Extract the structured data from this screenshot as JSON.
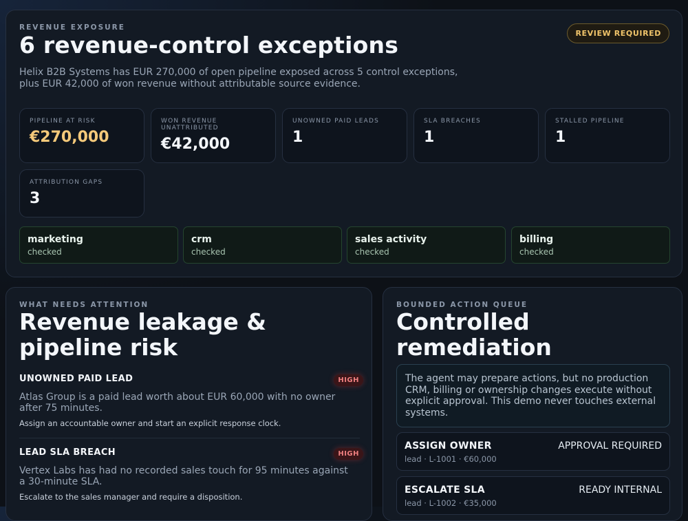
{
  "header": {
    "eyebrow": "REVENUE EXPOSURE",
    "title": "6 revenue-control exceptions",
    "badge": "REVIEW REQUIRED",
    "summary": "Helix B2B Systems has EUR 270,000 of open pipeline exposed across 5 control exceptions, plus EUR 42,000 of won revenue without attributable source evidence."
  },
  "metrics": [
    {
      "label": "PIPELINE AT RISK",
      "value": "€270,000"
    },
    {
      "label": "WON REVENUE UNATTRIBUTED",
      "value": "€42,000"
    },
    {
      "label": "UNOWNED PAID LEADS",
      "value": "1"
    },
    {
      "label": "SLA BREACHES",
      "value": "1"
    },
    {
      "label": "STALLED PIPELINE",
      "value": "1"
    },
    {
      "label": "ATTRIBUTION GAPS",
      "value": "3"
    }
  ],
  "sources": [
    {
      "name": "marketing",
      "status": "checked"
    },
    {
      "name": "crm",
      "status": "checked"
    },
    {
      "name": "sales activity",
      "status": "checked"
    },
    {
      "name": "billing",
      "status": "checked"
    }
  ],
  "attention": {
    "eyebrow": "WHAT NEEDS ATTENTION",
    "title": "Revenue leakage & pipeline risk",
    "items": [
      {
        "title": "UNOWNED PAID LEAD",
        "severity": "HIGH",
        "description": "Atlas Group is a paid lead worth about EUR 60,000 with no owner after 75 minutes.",
        "action": "Assign an accountable owner and start an explicit response clock."
      },
      {
        "title": "LEAD SLA BREACH",
        "severity": "HIGH",
        "description": "Vertex Labs has had no recorded sales touch for 95 minutes against a 30-minute SLA.",
        "action": "Escalate to the sales manager and require a disposition."
      }
    ]
  },
  "queue": {
    "eyebrow": "BOUNDED ACTION QUEUE",
    "title": "Controlled remediation",
    "note": "The agent may prepare actions, but no production CRM, billing or ownership changes execute without explicit approval. This demo never touches external systems.",
    "actions": [
      {
        "name": "ASSIGN OWNER",
        "status": "APPROVAL REQUIRED",
        "meta": "lead · L-1001 · €60,000"
      },
      {
        "name": "ESCALATE SLA",
        "status": "READY INTERNAL",
        "meta": "lead · L-1002 · €35,000"
      }
    ]
  },
  "colors": {
    "background": "#0d1117",
    "card": "#131a24",
    "accent_gold": "#f4c97a",
    "severity_high": "#f08080",
    "source_ok_border": "#25452f"
  }
}
